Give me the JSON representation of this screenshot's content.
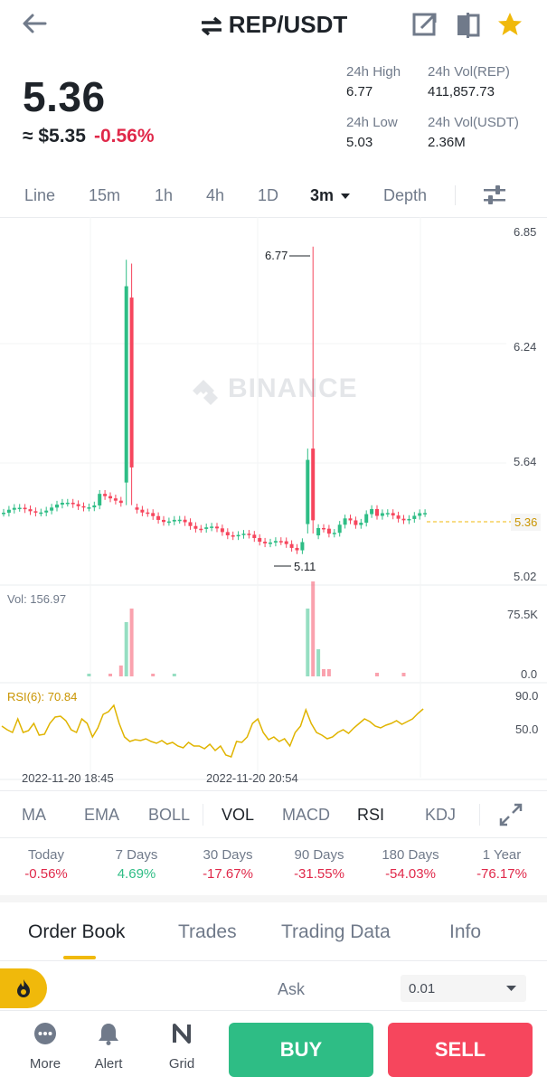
{
  "header": {
    "pair": "REP/USDT"
  },
  "price": {
    "last": "5.36",
    "usd_prefix": "≈ $5.35",
    "change": "-0.56%"
  },
  "stats": {
    "high_label": "24h High",
    "high_value": "6.77",
    "low_label": "24h Low",
    "low_value": "5.03",
    "vol_base_label": "24h Vol(REP)",
    "vol_base_value": "411,857.73",
    "vol_quote_label": "24h Vol(USDT)",
    "vol_quote_value": "2.36M"
  },
  "intervals": {
    "items": [
      "Line",
      "15m",
      "1h",
      "4h",
      "1D",
      "3m",
      "Depth"
    ],
    "active": "3m"
  },
  "chart_labels": {
    "y_ticks": [
      "6.85",
      "6.24",
      "5.64",
      "5.02"
    ],
    "current_price_tag": "5.36",
    "high_marker": "6.77",
    "low_marker": "5.11",
    "watermark": "BINANCE",
    "vol_label": "Vol: 156.97",
    "vol_ticks": [
      "75.5K",
      "0.0"
    ],
    "rsi_label": "RSI(6): 70.84",
    "rsi_ticks": [
      "90.0",
      "50.0"
    ],
    "time_ticks": [
      "2022-11-20 18:45",
      "2022-11-20 20:54"
    ]
  },
  "indicators": {
    "items": [
      "MA",
      "EMA",
      "BOLL",
      "VOL",
      "MACD",
      "RSI",
      "KDJ"
    ],
    "active": [
      "VOL",
      "RSI"
    ]
  },
  "performance": [
    {
      "label": "Today",
      "value": "-0.56%"
    },
    {
      "label": "7 Days",
      "value": "4.69%"
    },
    {
      "label": "30 Days",
      "value": "-17.67%"
    },
    {
      "label": "90 Days",
      "value": "-31.55%"
    },
    {
      "label": "180 Days",
      "value": "-54.03%"
    },
    {
      "label": "1 Year",
      "value": "-76.17%"
    }
  ],
  "tabs": {
    "items": [
      "Order Book",
      "Trades",
      "Trading Data",
      "Info"
    ],
    "active": "Order Book"
  },
  "orderbook": {
    "ask_label": "Ask",
    "precision": "0.01"
  },
  "bottom": {
    "more": "More",
    "alert": "Alert",
    "grid": "Grid",
    "buy": "BUY",
    "sell": "SELL"
  },
  "colors": {
    "up": "#2ebd85",
    "down": "#f6465d",
    "accent": "#f0b90b",
    "rsi": "#e0b400"
  },
  "chart_data": {
    "type": "candlestick",
    "y_range": [
      5.02,
      6.85
    ],
    "high": 6.77,
    "low": 5.11,
    "last": 5.36,
    "rsi_value": 70.84,
    "volume_last": 156.97
  }
}
